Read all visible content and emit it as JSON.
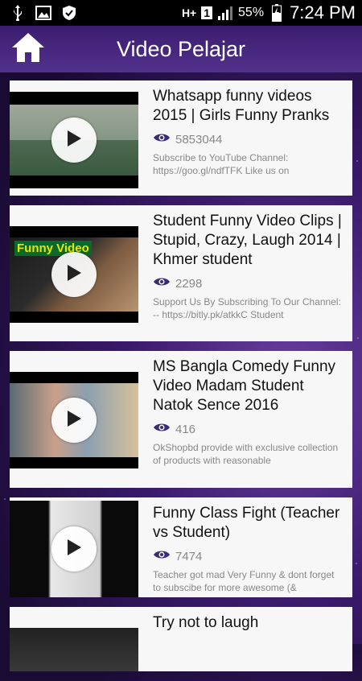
{
  "statusbar": {
    "icons_left": [
      "usb-icon",
      "image-icon",
      "shield-icon"
    ],
    "network": "H+",
    "sim": "1",
    "battery_pct": "55%",
    "time": "7:24 PM"
  },
  "appbar": {
    "title": "Video Pelajar",
    "home_icon": "home-icon"
  },
  "videos": [
    {
      "title": "Whatsapp funny videos 2015 | Girls Funny Pranks",
      "views": "5853044",
      "description": "Subscribe to YouTube Channel: https://goo.gl/ndfTFK   Like us on"
    },
    {
      "title": "Student Funny Video Clips | Stupid, Crazy, Laugh 2014 | Khmer student",
      "views": "2298",
      "description": "Support Us By Subscribing To Our Channel: -- https://bitly.pk/atkkC Student",
      "thumb_text": "Funny Video"
    },
    {
      "title": "MS Bangla Comedy Funny Video Madam Student Natok Sence 2016",
      "views": "416",
      "description": "OkShopbd provide with exclusive collection of products with reasonable"
    },
    {
      "title": "Funny Class Fight (Teacher vs Student)",
      "views": "7474",
      "description": "Teacher got mad Very Funny & dont forget to subscibe for more awesome (&"
    },
    {
      "title": "Try not to laugh",
      "views": "",
      "description": ""
    }
  ],
  "colors": {
    "appbar": "#4a2a80",
    "eye": "#3b2a7a",
    "card": "#f7f7f7"
  }
}
